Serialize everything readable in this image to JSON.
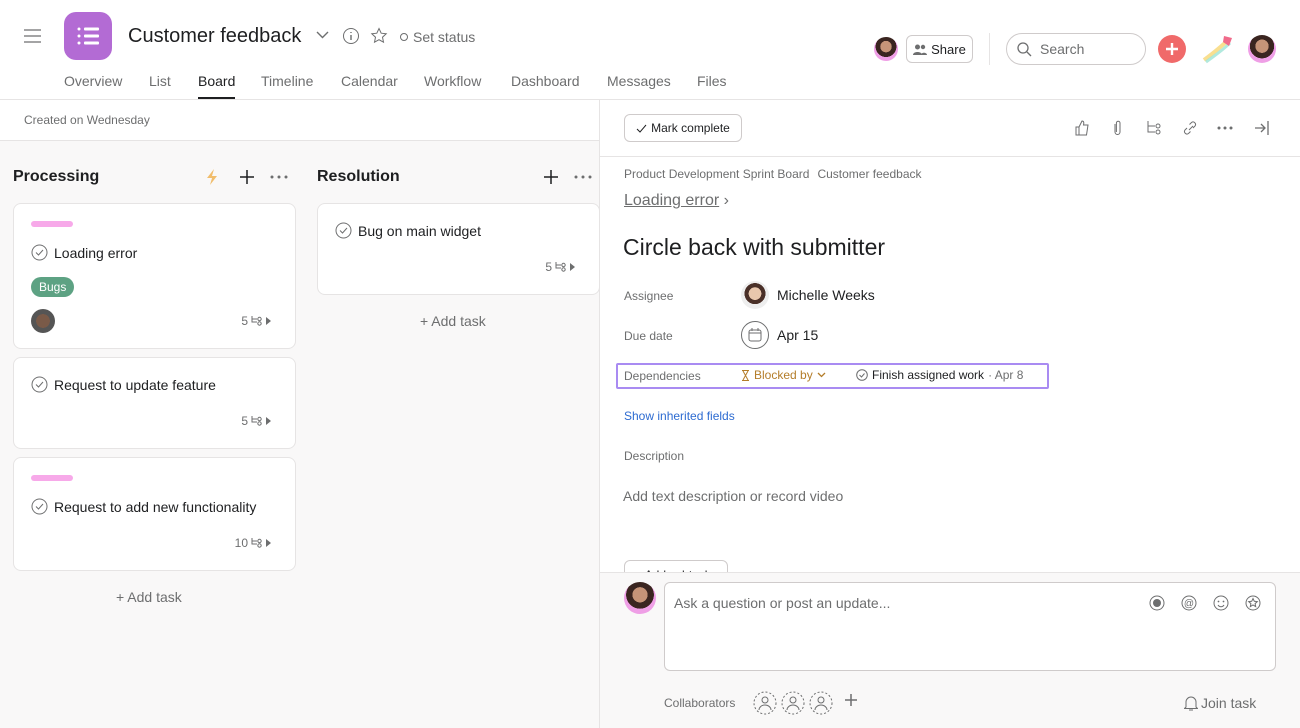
{
  "header": {
    "title": "Customer feedback",
    "set_status": "Set status",
    "share": "Share",
    "search_placeholder": "Search",
    "tabs": [
      "Overview",
      "List",
      "Board",
      "Timeline",
      "Calendar",
      "Workflow",
      "Dashboard",
      "Messages",
      "Files"
    ],
    "active_tab": "Board"
  },
  "board": {
    "created": "Created on Wednesday",
    "columns": [
      {
        "title": "Processing",
        "add_task": "+ Add task",
        "cards": [
          {
            "title": "Loading error",
            "tag": "Bugs",
            "subtasks": "5",
            "color": "#f7a9e9"
          },
          {
            "title": "Request to update feature",
            "subtasks": "5"
          },
          {
            "title": "Request to add new functionality",
            "subtasks": "10",
            "color": "#f7a9e9"
          }
        ]
      },
      {
        "title": "Resolution",
        "add_task": "+ Add task",
        "cards": [
          {
            "title": "Bug on main widget",
            "subtasks": "5"
          }
        ]
      }
    ]
  },
  "task": {
    "mark_complete": "Mark complete",
    "breadcrumb": [
      "Product Development Sprint Board",
      "Customer feedback"
    ],
    "parent": "Loading error",
    "title": "Circle back with submitter",
    "fields": {
      "assignee_label": "Assignee",
      "assignee": "Michelle Weeks",
      "due_label": "Due date",
      "due": "Apr 15",
      "dep_label": "Dependencies",
      "blocked_by": "Blocked by",
      "dep_task": "Finish assigned work",
      "dep_date": "· Apr 8"
    },
    "show_inherited": "Show inherited fields",
    "desc_label": "Description",
    "desc_placeholder": "Add text description or record video",
    "add_subtask": "+ Add subtask",
    "comment_placeholder": "Ask a question or post an update...",
    "collaborators": "Collaborators",
    "join": "Join task"
  },
  "colors": {
    "accent": "#b36bd4",
    "tag": "#5da283",
    "blocked": "#b47d2a",
    "link": "#2d6bd1",
    "add": "#f06a6a",
    "highlight": "#a98bf2"
  }
}
